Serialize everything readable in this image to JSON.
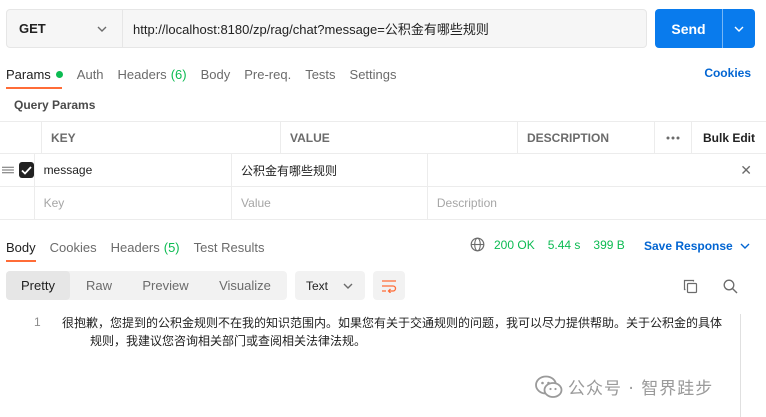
{
  "request": {
    "method": "GET",
    "url": "http://localhost:8180/zp/rag/chat?message=公积金有哪些规则",
    "send_label": "Send"
  },
  "request_tabs": {
    "params": "Params",
    "auth": "Auth",
    "headers": "Headers",
    "headers_count": "(6)",
    "body": "Body",
    "prereq": "Pre-req.",
    "tests": "Tests",
    "settings": "Settings",
    "cookies": "Cookies"
  },
  "query_params": {
    "title": "Query Params",
    "columns": {
      "key": "KEY",
      "value": "VALUE",
      "description": "DESCRIPTION",
      "bulk_edit": "Bulk Edit"
    },
    "rows": [
      {
        "key": "message",
        "value": "公积金有哪些规则",
        "description": "",
        "checked": true
      }
    ],
    "placeholders": {
      "key": "Key",
      "value": "Value",
      "description": "Description"
    }
  },
  "response_tabs": {
    "body": "Body",
    "cookies": "Cookies",
    "headers": "Headers",
    "headers_count": "(5)",
    "test_results": "Test Results"
  },
  "response_status": {
    "status": "200 OK",
    "time": "5.44 s",
    "size": "399 B",
    "save_response": "Save Response"
  },
  "view_modes": {
    "pretty": "Pretty",
    "raw": "Raw",
    "preview": "Preview",
    "visualize": "Visualize",
    "format": "Text"
  },
  "response_body": {
    "line_number": "1",
    "line1": "很抱歉，您提到的公积金规则不在我的知识范围内。如果您有关于交通规则的问题，我可以尽力提供帮助。关于公积金的具体",
    "line2": "规则，我建议您咨询相关部门或查阅相关法律法规。"
  },
  "watermark": "公众号 · 智界跬步",
  "colors": {
    "accent": "#ff6c37",
    "send": "#097bed",
    "link": "#0265d2",
    "success": "#0cbb52"
  }
}
